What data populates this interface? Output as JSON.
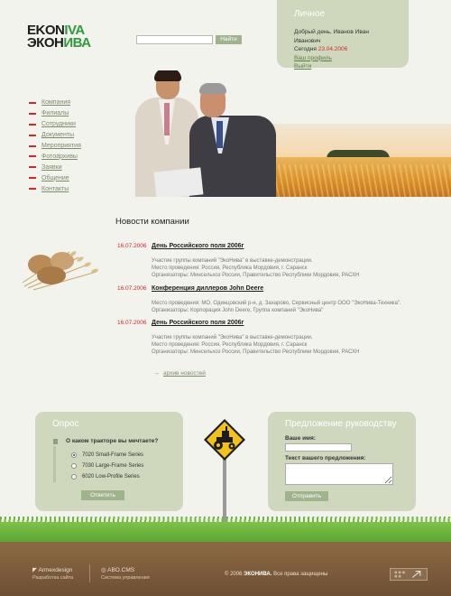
{
  "logo": {
    "line1_prefix": "EKON",
    "line1_accent": "IVA",
    "line2_prefix": "ЭКОН",
    "line2_accent": "ИВА"
  },
  "search": {
    "button_label": "Найти",
    "placeholder": ""
  },
  "personal": {
    "title": "Личное",
    "greeting": "Добрый день, Иванов Иван Иванович",
    "today_label": "Сегодня",
    "today_date": "23.04.2006",
    "profile_link": "Ваш профиль",
    "logout_link": "Выйти"
  },
  "menu": {
    "items": [
      {
        "label": "Компания"
      },
      {
        "label": "Филиалы"
      },
      {
        "label": "Сотрудники"
      },
      {
        "label": "Документы"
      },
      {
        "label": "Мероприятия"
      },
      {
        "label": "Фотоархивы"
      },
      {
        "label": "Заявки"
      },
      {
        "label": "Общение"
      },
      {
        "label": "Контакты"
      }
    ]
  },
  "news": {
    "title": "Новости компании",
    "items": [
      {
        "date": "16.07.2006",
        "headline": "День Российского поля 2006г",
        "lines": [
          "Участие группы компаний \"ЭкоНива\" в выставке-демонстрации.",
          "Место проведения: Россия, Республика Мордовия, г. Саранск",
          "Организаторы: Минсельхоз России, Правительство Республики Мордовия, РАСХН"
        ]
      },
      {
        "date": "16.07.2006",
        "headline": "Конференция диллеров John Deere",
        "lines": [
          "Место проведения: МО, Одинцовский р-н, д. Захарово, Сервисный центр ООО \"ЭкоНива-Техника\".",
          "Организаторы: Корпорация John Deere, Группа компаний \"ЭкоНива\""
        ]
      },
      {
        "date": "16.07.2006",
        "headline": "День Российского поля 2006г",
        "lines": [
          "Участие группы компаний \"ЭкоНива\" в выставке-демонстрации.",
          "Место проведения: Россия, Республика Мордовия, г. Саранск",
          "Организаторы: Минсельхоз России, Правительство Республики Мордовия, РАСХН"
        ]
      }
    ],
    "archive_link": "архив новостей"
  },
  "poll": {
    "title": "Опрос",
    "question": "О каком тракторе вы мечтаете?",
    "options": [
      {
        "label": "7020 Small-Frame Series",
        "selected": true
      },
      {
        "label": "7030 Large-Frame Series",
        "selected": false
      },
      {
        "label": "6020 Low-Profile Series",
        "selected": false
      }
    ],
    "submit_label": "Ответить"
  },
  "proposal": {
    "title": "Предложение руководству",
    "name_label": "Ваше имя:",
    "text_label": "Текст вашего предложения:",
    "submit_label": "Отправить"
  },
  "footer": {
    "dev_name": "Armexdesign",
    "dev_caption": "Разработка сайта",
    "cms_name": "ABO.CMS",
    "cms_caption": "Система управления",
    "copyright_prefix": "© 2006",
    "copyright_brand": "ЭКОНИВА.",
    "copyright_suffix": "Все права защищены"
  },
  "colors": {
    "accent_red": "#d8262b",
    "panel_green": "#cfd8bd",
    "button_green": "#9fb48c",
    "logo_green": "#2e9a3a"
  }
}
